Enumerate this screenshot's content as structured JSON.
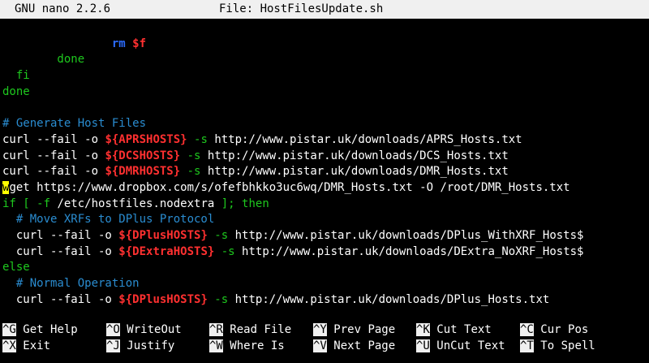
{
  "title_bar": {
    "app": "GNU nano 2.2.6",
    "file_label": "File: HostFilesUpdate.sh"
  },
  "lines": [
    [
      {
        "t": " ",
        "c": "white"
      }
    ],
    [
      {
        "t": "                ",
        "c": "white"
      },
      {
        "t": "rm",
        "c": "blue"
      },
      {
        "t": " ",
        "c": "white"
      },
      {
        "t": "$f",
        "c": "redb"
      }
    ],
    [
      {
        "t": "        done",
        "c": "green"
      }
    ],
    [
      {
        "t": "  fi",
        "c": "green"
      }
    ],
    [
      {
        "t": "done",
        "c": "green"
      }
    ],
    [
      {
        "t": " ",
        "c": "white"
      }
    ],
    [
      {
        "t": "# Generate Host Files",
        "c": "cyan"
      }
    ],
    [
      {
        "t": "curl --fail -o ",
        "c": "white"
      },
      {
        "t": "${APRSHOSTS}",
        "c": "redb"
      },
      {
        "t": " -s",
        "c": "green"
      },
      {
        "t": " http://www.pistar.uk/downloads/APRS_Hosts.txt",
        "c": "white"
      }
    ],
    [
      {
        "t": "curl --fail -o ",
        "c": "white"
      },
      {
        "t": "${DCSHOSTS}",
        "c": "redb"
      },
      {
        "t": " -s",
        "c": "green"
      },
      {
        "t": " http://www.pistar.uk/downloads/DCS_Hosts.txt",
        "c": "white"
      }
    ],
    [
      {
        "t": "curl --fail -o ",
        "c": "white"
      },
      {
        "t": "${DMRHOSTS}",
        "c": "redb"
      },
      {
        "t": " -s",
        "c": "green"
      },
      {
        "t": " http://www.pistar.uk/downloads/DMR_Hosts.txt",
        "c": "white"
      }
    ],
    [
      {
        "t": "w",
        "c": "cursor"
      },
      {
        "t": "get https://www.dropbox.com/s/ofefbhkko3uc6wq/DMR_Hosts.txt -O /root/DMR_Hosts.txt",
        "c": "white"
      }
    ],
    [
      {
        "t": "if [ -f ",
        "c": "green"
      },
      {
        "t": "/etc/hostfiles.nodextra",
        "c": "white"
      },
      {
        "t": " ]; then",
        "c": "green"
      }
    ],
    [
      {
        "t": "  # Move XRFs to DPlus Protocol",
        "c": "cyan"
      }
    ],
    [
      {
        "t": "  curl --fail -o ",
        "c": "white"
      },
      {
        "t": "${DPlusHOSTS}",
        "c": "redb"
      },
      {
        "t": " -s",
        "c": "green"
      },
      {
        "t": " http://www.pistar.uk/downloads/DPlus_WithXRF_Hosts$",
        "c": "white"
      }
    ],
    [
      {
        "t": "  curl --fail -o ",
        "c": "white"
      },
      {
        "t": "${DExtraHOSTS}",
        "c": "redb"
      },
      {
        "t": " -s",
        "c": "green"
      },
      {
        "t": " http://www.pistar.uk/downloads/DExtra_NoXRF_Hosts$",
        "c": "white"
      }
    ],
    [
      {
        "t": "else",
        "c": "green"
      }
    ],
    [
      {
        "t": "  # Normal Operation",
        "c": "cyan"
      }
    ],
    [
      {
        "t": "  curl --fail -o ",
        "c": "white"
      },
      {
        "t": "${DPlusHOSTS}",
        "c": "redb"
      },
      {
        "t": " -s",
        "c": "green"
      },
      {
        "t": " http://www.pistar.uk/downloads/DPlus_Hosts.txt",
        "c": "white"
      }
    ]
  ],
  "shortcuts": [
    [
      {
        "key": "^G",
        "label": "Get Help"
      },
      {
        "key": "^O",
        "label": "WriteOut"
      },
      {
        "key": "^R",
        "label": "Read File"
      },
      {
        "key": "^Y",
        "label": "Prev Page"
      },
      {
        "key": "^K",
        "label": "Cut Text"
      },
      {
        "key": "^C",
        "label": "Cur Pos"
      }
    ],
    [
      {
        "key": "^X",
        "label": "Exit"
      },
      {
        "key": "^J",
        "label": "Justify"
      },
      {
        "key": "^W",
        "label": "Where Is"
      },
      {
        "key": "^V",
        "label": "Next Page"
      },
      {
        "key": "^U",
        "label": "UnCut Text"
      },
      {
        "key": "^T",
        "label": "To Spell"
      }
    ]
  ],
  "colors": {
    "background": "#000000",
    "text": "#ffffff",
    "keyword": "#1ec81e",
    "comment": "#2a8cd0",
    "variable": "#ff3030",
    "command": "#2c6cff",
    "cursor": "#ffff00",
    "bar": "#f0f0f0"
  }
}
